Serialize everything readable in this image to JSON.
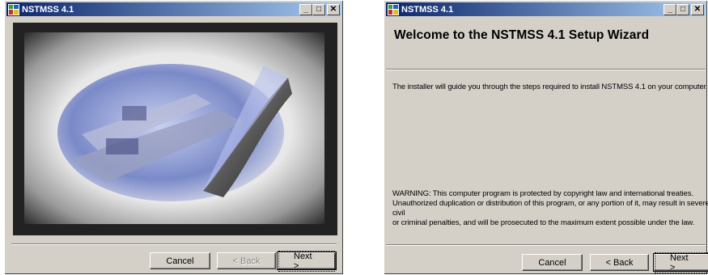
{
  "window1": {
    "title": "NSTMSS 4.1",
    "buttons": {
      "cancel": "Cancel",
      "back": "< Back",
      "next": "Next >"
    }
  },
  "window2": {
    "title": "NSTMSS 4.1",
    "heading": "Welcome to the NSTMSS 4.1 Setup Wizard",
    "intro": "The installer will guide you through the steps required to install NSTMSS 4.1 on your computer.",
    "warning": [
      "WARNING: This computer program is protected by copyright law and international treaties.",
      "Unauthorized duplication or distribution of this program, or any portion of it, may result in severe civil",
      "or criminal penalties, and will be prosecuted to the maximum extent possible under the law."
    ],
    "buttons": {
      "cancel": "Cancel",
      "back": "< Back",
      "next": "Next >"
    }
  },
  "colors": {
    "titlebar_start": "#0a246a",
    "titlebar_end": "#a6caf0",
    "face": "#d4d0c8"
  }
}
